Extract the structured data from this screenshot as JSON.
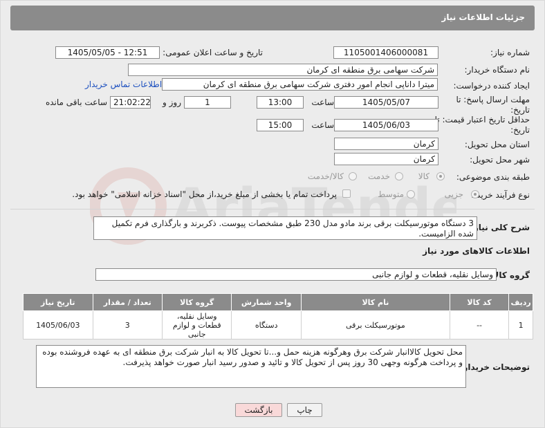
{
  "header": {
    "title": "جزئیات اطلاعات نیاز"
  },
  "fields": {
    "need_number_label": "شماره نیاز:",
    "need_number": "1105001406000081",
    "announce_label": "تاریخ و ساعت اعلان عمومی:",
    "announce_value": "1405/05/05 - 12:51",
    "buyer_org_label": "نام دستگاه خریدار:",
    "buyer_org": "شرکت سهامی برق منطقه ای کرمان",
    "creator_label": "ایجاد کننده درخواست:",
    "creator": "میترا داناپی انجام امور دفتری شرکت سهامی برق منطقه ای کرمان",
    "contact_link": "اطلاعات تماس خریدار",
    "deadline_label": "مهلت ارسال پاسخ: تا تاریخ:",
    "deadline_date": "1405/05/07",
    "time_label": "ساعت",
    "deadline_time": "13:00",
    "days_value": "1",
    "days_label": "روز و",
    "remaining_time": "21:02:22",
    "remaining_label": "ساعت باقی مانده",
    "validity_label": "حداقل تاریخ اعتبار قیمت: تا تاریخ:",
    "validity_date": "1405/06/03",
    "validity_time": "15:00",
    "province_label": "استان محل تحویل:",
    "province": "کرمان",
    "city_label": "شهر محل تحویل:",
    "city": "کرمان",
    "category_label": "طبقه بندی موضوعی:",
    "category_options": [
      "کالا",
      "خدمت",
      "کالا/خدمت"
    ],
    "process_label": "نوع فرآیند خرید :",
    "process_options": [
      "جزیی",
      "متوسط"
    ],
    "payment_note": "پرداخت تمام یا بخشی از مبلغ خرید،از محل \"اسناد خزانه اسلامی\" خواهد بود."
  },
  "description": {
    "label": "شرح کلی نیاز:",
    "text": "3 دستگاه موتورسیکلت برقی برند مادو مدل 230 طبق مشخصات پیوست. ذکربرند و بارگذاری فرم تکمیل شده الزامیست."
  },
  "goods": {
    "section_title": "اطلاعات کالاهای مورد نیاز",
    "group_label": "گروه کالا:",
    "group_value": "وسایل نقلیه، قطعات و لوازم جانبی",
    "columns": [
      "ردیف",
      "کد کالا",
      "نام کالا",
      "واحد شمارش",
      "گروه کالا",
      "تعداد / مقدار",
      "تاریخ نیاز"
    ],
    "rows": [
      [
        "1",
        "--",
        "موتورسیکلت برقی",
        "دستگاه",
        "وسایل نقلیه، قطعات و لوازم جانبی",
        "3",
        "1405/06/03"
      ]
    ]
  },
  "buyer_notes": {
    "label": "توضیحات خریدار:",
    "text": "محل تحویل کالاانبار شرکت برق وهرگونه هزینه حمل و...تا تحویل کالا به انبار شرکت برق منطقه ای به عهده فروشنده بوده و پرداخت هرگونه وجهی 30 روز پس از تحویل کالا و تائید و صدور رسید انبار صورت خواهد پذیرفت."
  },
  "buttons": {
    "print": "چاپ",
    "back": "بازگشت"
  },
  "watermark": "AriaTender.net",
  "colors": {
    "header": "#8b8b8b",
    "link": "#1b4fbf",
    "back_button": "#f9d9d9"
  }
}
